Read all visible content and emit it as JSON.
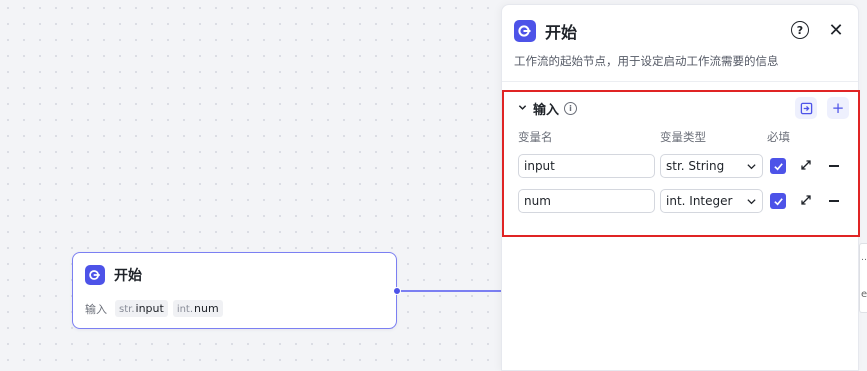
{
  "node": {
    "title": "开始",
    "inputs_label": "输入",
    "inputs": [
      {
        "type": "str.",
        "name": "input"
      },
      {
        "type": "int.",
        "name": "num"
      }
    ]
  },
  "panel": {
    "title": "开始",
    "description": "工作流的起始节点，用于设定启动工作流需要的信息",
    "help_glyph": "?",
    "close_glyph": "✕",
    "section": {
      "title": "输入",
      "info_glyph": "i",
      "add_glyph": "+",
      "columns": {
        "name": "变量名",
        "type": "变量类型",
        "required": "必填"
      },
      "rows": [
        {
          "name": "input",
          "type": "str. String",
          "required": true
        },
        {
          "name": "num",
          "type": "int. Integer",
          "required": true
        }
      ]
    }
  },
  "side": {
    "dots": "…",
    "e": "e"
  },
  "colors": {
    "accent": "#4d53e8",
    "highlight_border": "#e02424"
  }
}
